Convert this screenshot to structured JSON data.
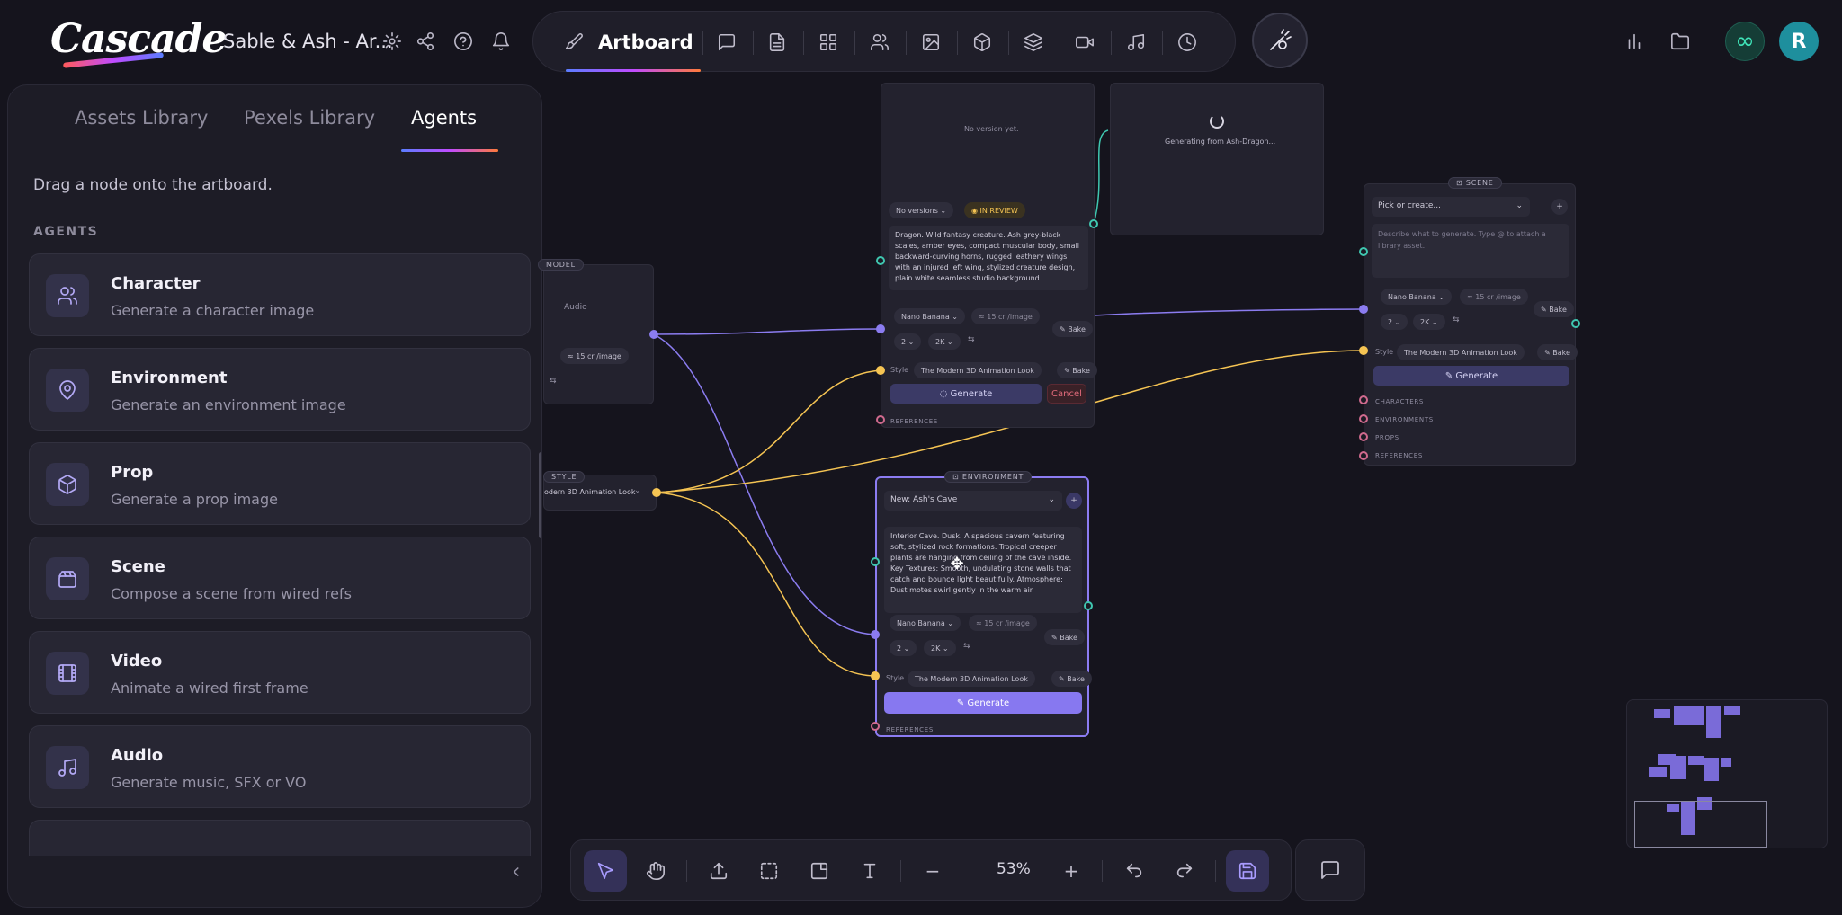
{
  "app": {
    "logo_text": "Cascade",
    "project_title": "Sable & Ash - Ar..."
  },
  "toolbar": {
    "artboard_label": "Artboard"
  },
  "left_panel": {
    "tabs": [
      "Assets Library",
      "Pexels Library",
      "Agents"
    ],
    "active_tab": "Agents",
    "hint": "Drag a node onto the artboard.",
    "section_label": "AGENTS",
    "agents": [
      {
        "title": "Character",
        "subtitle": "Generate a character image",
        "icon": "users-icon"
      },
      {
        "title": "Environment",
        "subtitle": "Generate an environment image",
        "icon": "map-pin-icon"
      },
      {
        "title": "Prop",
        "subtitle": "Generate a prop image",
        "icon": "cube-icon"
      },
      {
        "title": "Scene",
        "subtitle": "Compose a scene from wired refs",
        "icon": "clapperboard-icon"
      },
      {
        "title": "Video",
        "subtitle": "Animate a wired first frame",
        "icon": "film-icon"
      },
      {
        "title": "Audio",
        "subtitle": "Generate music, SFX or VO",
        "icon": "music-icon"
      }
    ]
  },
  "canvas": {
    "model_node": {
      "tag": "MODEL",
      "text": "Audio",
      "cost": "≈ 15 cr /image"
    },
    "style_node": {
      "tag": "STYLE",
      "value": "odern 3D Animation Look"
    },
    "character_node": {
      "no_version": "No version yet.",
      "versions": "No versions",
      "status": "IN REVIEW",
      "prompt": "Dragon. Wild fantasy creature. Ash grey-black scales, amber eyes, compact muscular body, small backward-curving horns, rugged leathery wings with an injured left wing, stylized creature design, plain white seamless studio background.",
      "model": "Nano Banana",
      "cost": "≈ 15 cr /image",
      "count": "2",
      "res": "2K",
      "bake": "Bake",
      "style_label": "Style",
      "style_value": "The Modern 3D Animation Look",
      "generate": "Generate",
      "cancel": "Cancel",
      "references": "REFERENCES"
    },
    "generating_node": {
      "text": "Generating from Ash-Dragon..."
    },
    "scene_node": {
      "tag": "SCENE",
      "picker": "Pick or create...",
      "placeholder": "Describe what to generate. Type @ to attach a library asset.",
      "model": "Nano Banana",
      "cost": "≈ 15 cr /image",
      "count": "2",
      "res": "2K",
      "bake": "Bake",
      "style_label": "Style",
      "style_value": "The Modern 3D Animation Look",
      "generate": "Generate",
      "refs": [
        "CHARACTERS",
        "ENVIRONMENTS",
        "PROPS",
        "REFERENCES"
      ]
    },
    "environment_node": {
      "tag": "ENVIRONMENT",
      "picker": "New: Ash's Cave",
      "prompt": "Interior Cave. Dusk. A spacious cavern featuring soft, stylized rock formations. Tropical creeper plants are hanging from ceiling of the cave inside. Key Textures: Smooth, undulating stone walls that catch and bounce light beautifully. Atmosphere: Dust motes swirl gently in the warm air",
      "model": "Nano Banana",
      "cost": "≈ 15 cr /image",
      "count": "2",
      "res": "2K",
      "bake": "Bake",
      "style_label": "Style",
      "style_value": "The Modern 3D Animation Look",
      "generate": "Generate",
      "references": "REFERENCES"
    }
  },
  "bottom_toolbar": {
    "zoom": "53%",
    "zoom_out": "−",
    "zoom_in": "+"
  },
  "colors": {
    "accent": "#8c7cf2",
    "violet_wire": "#8b7cf0",
    "yellow_wire": "#f5c453",
    "teal_wire": "#3fc7b0",
    "review_badge": "#f5c453"
  }
}
